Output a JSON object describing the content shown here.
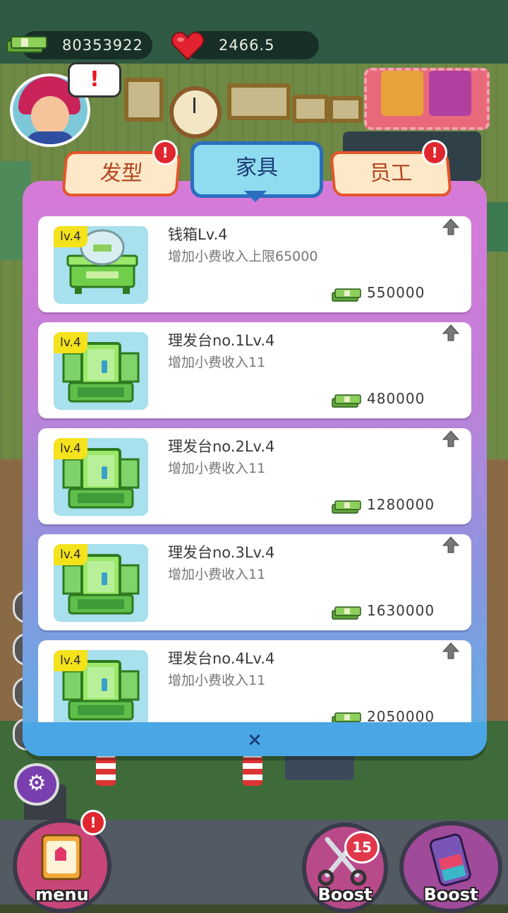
{
  "hud": {
    "cash": "80353922",
    "hearts": "2466.5"
  },
  "speech_mark": "!",
  "tabs": [
    {
      "label": "发型",
      "badge": "!",
      "active": false
    },
    {
      "label": "家具",
      "active": true
    },
    {
      "label": "员工",
      "badge": "!",
      "active": false
    }
  ],
  "items": [
    {
      "level": "lv.4",
      "title": "钱箱Lv.4",
      "desc": "增加小费收入上限65000",
      "price": "550000",
      "icon": "cash-box-icon"
    },
    {
      "level": "lv.4",
      "title": "理发台no.1Lv.4",
      "desc": "增加小费收入11",
      "price": "480000",
      "icon": "barber-station-icon"
    },
    {
      "level": "lv.4",
      "title": "理发台no.2Lv.4",
      "desc": "增加小费收入11",
      "price": "1280000",
      "icon": "barber-station-icon"
    },
    {
      "level": "lv.4",
      "title": "理发台no.3Lv.4",
      "desc": "增加小费收入11",
      "price": "1630000",
      "icon": "barber-station-icon"
    },
    {
      "level": "lv.4",
      "title": "理发台no.4Lv.4",
      "desc": "增加小费收入11",
      "price": "2050000",
      "icon": "barber-station-icon"
    }
  ],
  "close_label": "×",
  "bottom": {
    "menu_label": "menu",
    "menu_badge": "!",
    "boost1_label": "Boost",
    "boost1_count": "15",
    "boost2_label": "Boost"
  },
  "colors": {
    "dialog_top": "#d77ad8",
    "dialog_bottom": "#5ab0e6",
    "active_tab": "#8fdcf0",
    "inactive_tab": "#fde8c8",
    "level_badge": "#f4e21a"
  }
}
